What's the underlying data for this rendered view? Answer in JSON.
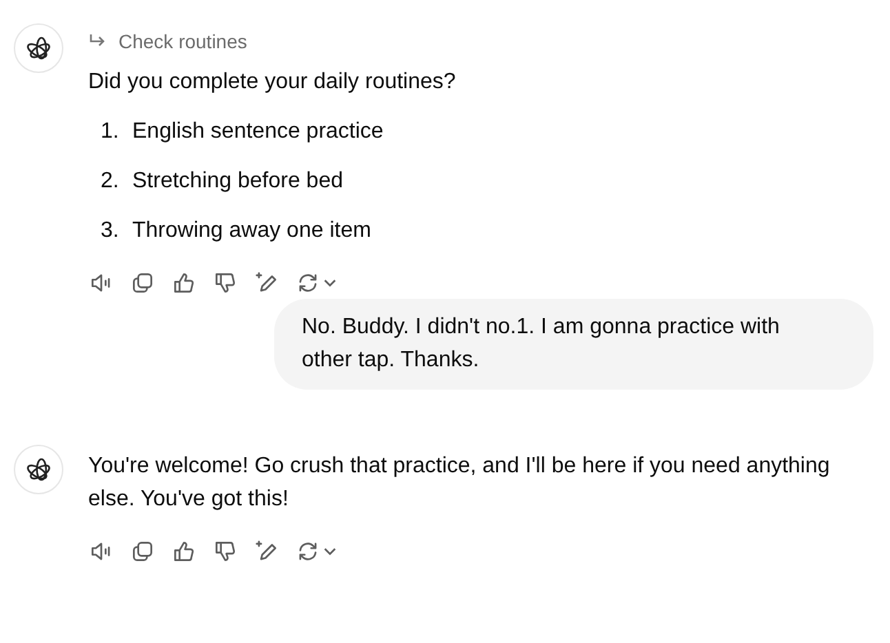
{
  "messages": [
    {
      "kind": "assistant",
      "reply_to": "Check routines",
      "text": "Did you complete your daily routines?",
      "items": [
        {
          "number": "1.",
          "text": "English sentence practice"
        },
        {
          "number": "2.",
          "text": "Stretching before bed"
        },
        {
          "number": "3.",
          "text": "Throwing away one item"
        }
      ]
    },
    {
      "kind": "user",
      "text": "No. Buddy. I didn't no.1. I am gonna practice with other tap. Thanks."
    },
    {
      "kind": "assistant",
      "text": "You're welcome! Go crush that practice, and I'll be here if you need anything else. You've got this!"
    }
  ]
}
